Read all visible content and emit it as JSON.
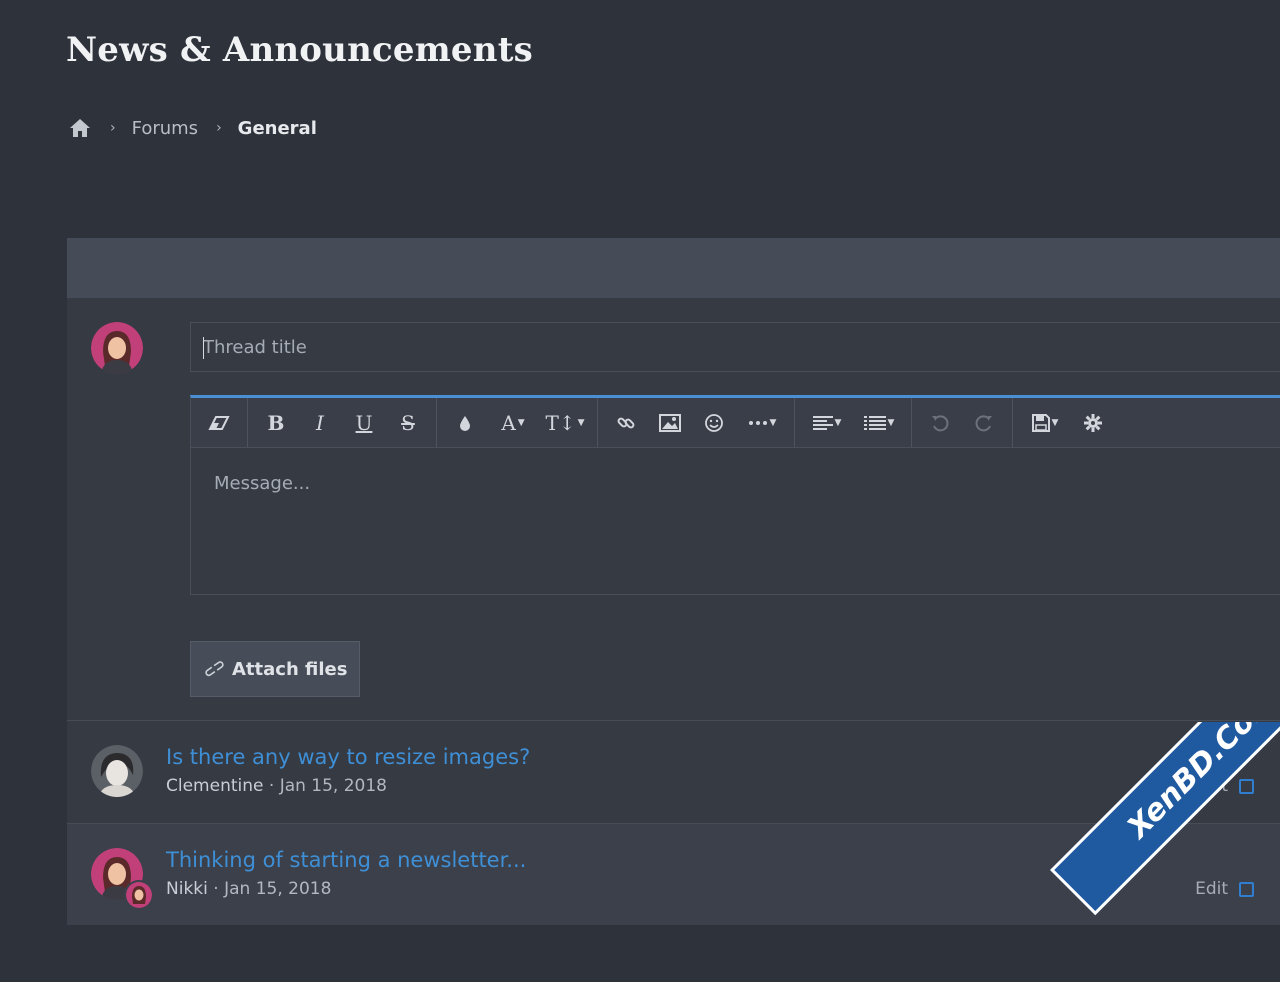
{
  "page": {
    "title": "News & Announcements"
  },
  "breadcrumb": {
    "home_icon": "home-icon",
    "items": [
      "Forums",
      "General"
    ]
  },
  "composer": {
    "title_placeholder": "Thread title",
    "message_placeholder": "Message...",
    "attach_label": "Attach files",
    "toolbar_icons": [
      "eraser-icon",
      "bold-icon",
      "italic-icon",
      "underline-icon",
      "strikethrough-icon",
      "text-color-icon",
      "font-family-icon",
      "font-size-icon",
      "link-icon",
      "image-icon",
      "smilie-icon",
      "more-icon",
      "align-icon",
      "list-icon",
      "undo-icon",
      "redo-icon",
      "drafts-icon",
      "settings-icon"
    ],
    "toolbar_glyphs": {
      "bold": "B",
      "italic": "I",
      "underline": "U",
      "strike": "S",
      "font": "A",
      "size": "T↕"
    }
  },
  "threads": [
    {
      "title": "Is there any way to resize images?",
      "author": "Clementine",
      "date": "Jan 15, 2018",
      "edit": "Edit"
    },
    {
      "title": "Thinking of starting a newsletter...",
      "author": "Nikki",
      "date": "Jan 15, 2018",
      "edit": "Edit"
    }
  ],
  "watermark": "XenBD.Com",
  "colors": {
    "background": "#2d323b",
    "block": "#353a43",
    "header": "#464c57",
    "link": "#3f8fd6",
    "accent": "#4a8ed3"
  }
}
